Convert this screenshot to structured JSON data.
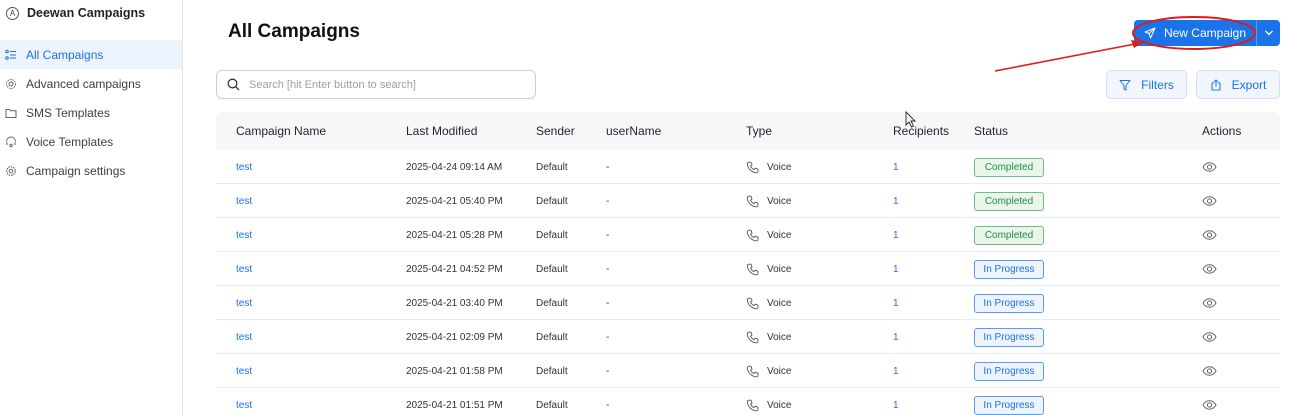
{
  "sidebar": {
    "brand": {
      "logo": "A",
      "name": "Deewan Campaigns"
    },
    "items": [
      {
        "label": "All Campaigns",
        "icon": "list-icon",
        "active": true
      },
      {
        "label": "Advanced campaigns",
        "icon": "gear-burst-icon",
        "active": false
      },
      {
        "label": "SMS Templates",
        "icon": "folder-icon",
        "active": false
      },
      {
        "label": "Voice Templates",
        "icon": "plugin-icon",
        "active": false
      },
      {
        "label": "Campaign settings",
        "icon": "settings-icon",
        "active": false
      }
    ]
  },
  "header": {
    "title": "All Campaigns",
    "new_campaign_label": "New Campaign"
  },
  "toolbar": {
    "search_placeholder": "Search [hit Enter button to search]",
    "filters_label": "Filters",
    "export_label": "Export"
  },
  "table": {
    "columns": [
      "Campaign Name",
      "Last Modified",
      "Sender",
      "userName",
      "Type",
      "Recipients",
      "Status",
      "Actions"
    ],
    "rows": [
      {
        "name": "test",
        "modified": "2025-04-24 09:14 AM",
        "sender": "Default",
        "user": "-",
        "type": "Voice",
        "recipients": "1",
        "status": "Completed"
      },
      {
        "name": "test",
        "modified": "2025-04-21 05:40 PM",
        "sender": "Default",
        "user": "-",
        "type": "Voice",
        "recipients": "1",
        "status": "Completed"
      },
      {
        "name": "test",
        "modified": "2025-04-21 05:28 PM",
        "sender": "Default",
        "user": "-",
        "type": "Voice",
        "recipients": "1",
        "status": "Completed"
      },
      {
        "name": "test",
        "modified": "2025-04-21 04:52 PM",
        "sender": "Default",
        "user": "-",
        "type": "Voice",
        "recipients": "1",
        "status": "In Progress"
      },
      {
        "name": "test",
        "modified": "2025-04-21 03:40 PM",
        "sender": "Default",
        "user": "-",
        "type": "Voice",
        "recipients": "1",
        "status": "In Progress"
      },
      {
        "name": "test",
        "modified": "2025-04-21 02:09 PM",
        "sender": "Default",
        "user": "-",
        "type": "Voice",
        "recipients": "1",
        "status": "In Progress"
      },
      {
        "name": "test",
        "modified": "2025-04-21 01:58 PM",
        "sender": "Default",
        "user": "-",
        "type": "Voice",
        "recipients": "1",
        "status": "In Progress"
      },
      {
        "name": "test",
        "modified": "2025-04-21 01:51 PM",
        "sender": "Default",
        "user": "-",
        "type": "Voice",
        "recipients": "1",
        "status": "In Progress"
      }
    ]
  },
  "colors": {
    "accent": "#1a73e8",
    "completed": "#1e8e3e",
    "annotation": "#e01b1b"
  }
}
